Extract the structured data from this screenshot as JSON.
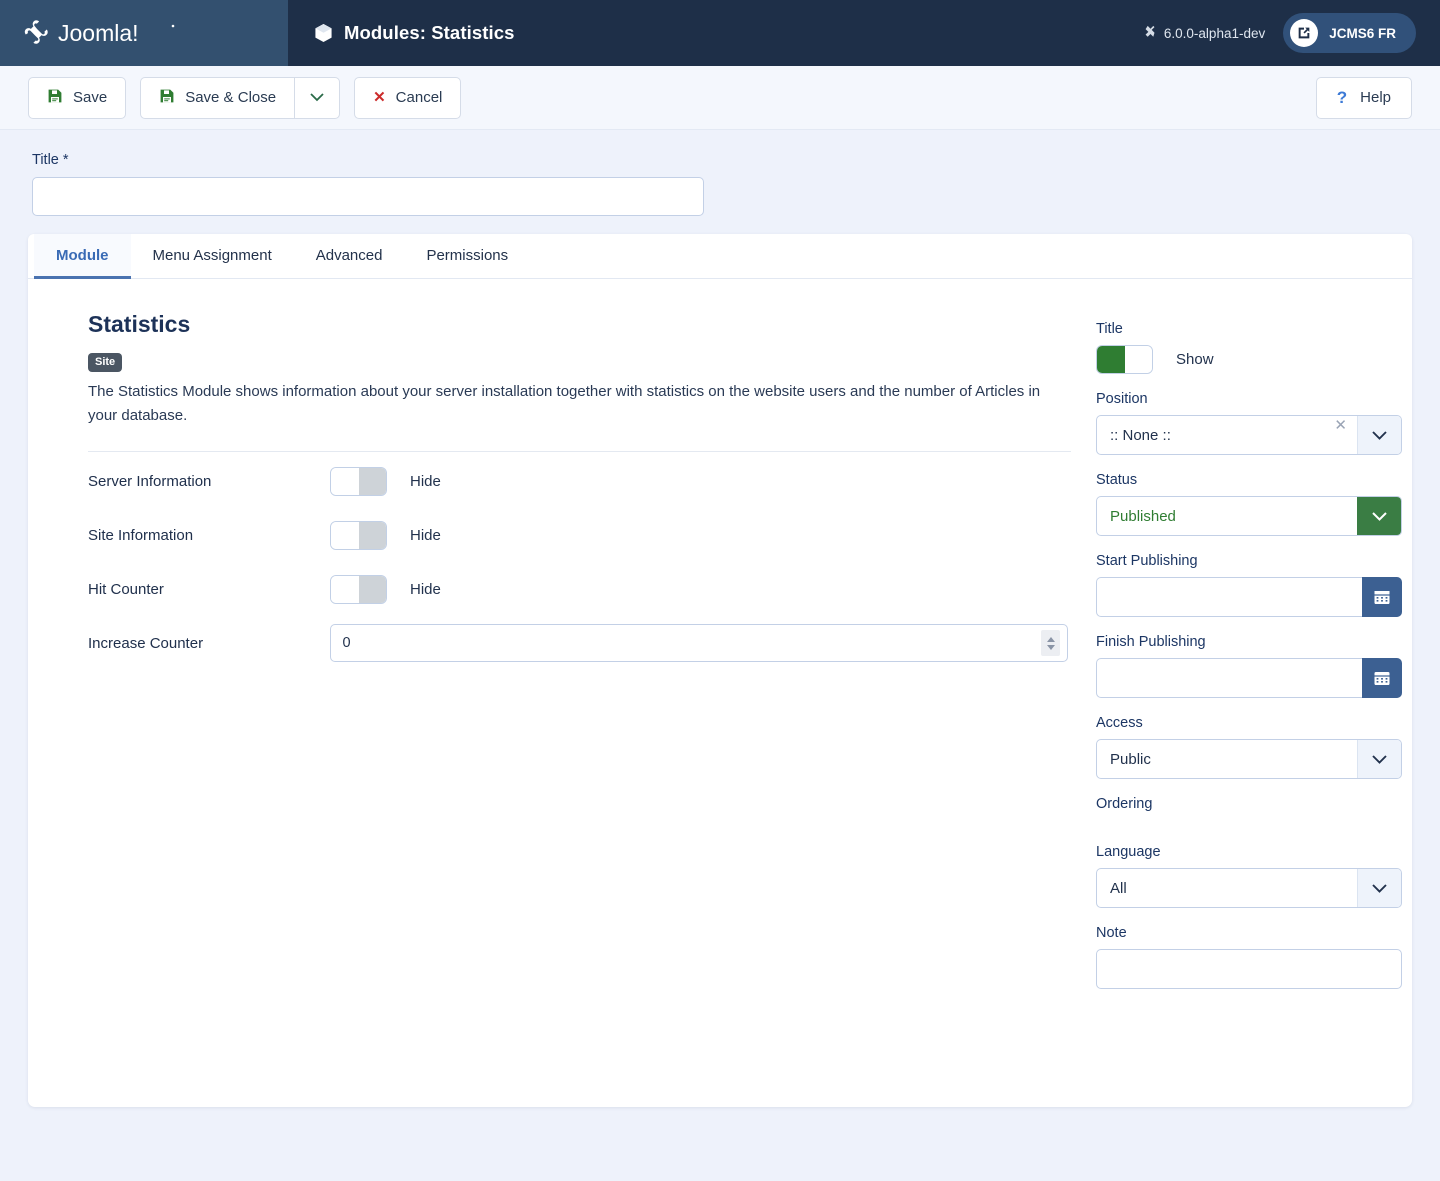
{
  "header": {
    "brand_name": "Joomla!",
    "page_title": "Modules: Statistics",
    "page_title_icon": "cube-icon",
    "version": "6.0.0-alpha1-dev",
    "site_pill_label": "JCMS6 FR",
    "site_pill_icon": "external-link-icon"
  },
  "toolbar": {
    "save_label": "Save",
    "save_close_label": "Save & Close",
    "save_close_caret_icon": "chevron-down-icon",
    "cancel_label": "Cancel",
    "cancel_icon": "x-icon",
    "help_label": "Help",
    "help_icon": "question-mark-icon",
    "save_icon": "floppy-disk-icon"
  },
  "title_field": {
    "label": "Title *",
    "value": "",
    "placeholder": ""
  },
  "tabs": [
    {
      "label": "Module",
      "active": true
    },
    {
      "label": "Menu Assignment",
      "active": false
    },
    {
      "label": "Advanced",
      "active": false
    },
    {
      "label": "Permissions",
      "active": false
    }
  ],
  "module": {
    "heading": "Statistics",
    "badge": "Site",
    "description": "The Statistics Module shows information about your server installation together with statistics on the website users and the number of Articles in your database.",
    "fields": [
      {
        "label": "Server Information",
        "state": "off",
        "state_label": "Hide"
      },
      {
        "label": "Site Information",
        "state": "off",
        "state_label": "Hide"
      },
      {
        "label": "Hit Counter",
        "state": "off",
        "state_label": "Hide"
      }
    ],
    "counter": {
      "label": "Increase Counter",
      "value": "0"
    }
  },
  "sidebar": {
    "title_toggle": {
      "label": "Title",
      "state": "on",
      "state_label": "Show"
    },
    "position": {
      "label": "Position",
      "value": ":: None ::",
      "clear_icon": "x-icon",
      "chevron_icon": "chevron-down-icon"
    },
    "status": {
      "label": "Status",
      "value": "Published",
      "chevron_icon": "chevron-down-icon"
    },
    "start_publishing": {
      "label": "Start Publishing",
      "value": "",
      "button_icon": "calendar-icon"
    },
    "finish_publishing": {
      "label": "Finish Publishing",
      "value": "",
      "button_icon": "calendar-icon"
    },
    "access": {
      "label": "Access",
      "value": "Public",
      "chevron_icon": "chevron-down-icon"
    },
    "ordering": {
      "label": "Ordering"
    },
    "language": {
      "label": "Language",
      "value": "All",
      "chevron_icon": "chevron-down-icon"
    },
    "note": {
      "label": "Note",
      "value": "",
      "placeholder": ""
    }
  },
  "colors": {
    "header_bg": "#1e2f48",
    "brand_bg": "#33506f",
    "page_bg": "#eef2fb",
    "accent_blue": "#3a6bb5",
    "status_green": "#3a7d44",
    "toggle_green": "#2f7d32",
    "cancel_red": "#cc2b2b",
    "date_btn_blue": "#3c6092"
  }
}
